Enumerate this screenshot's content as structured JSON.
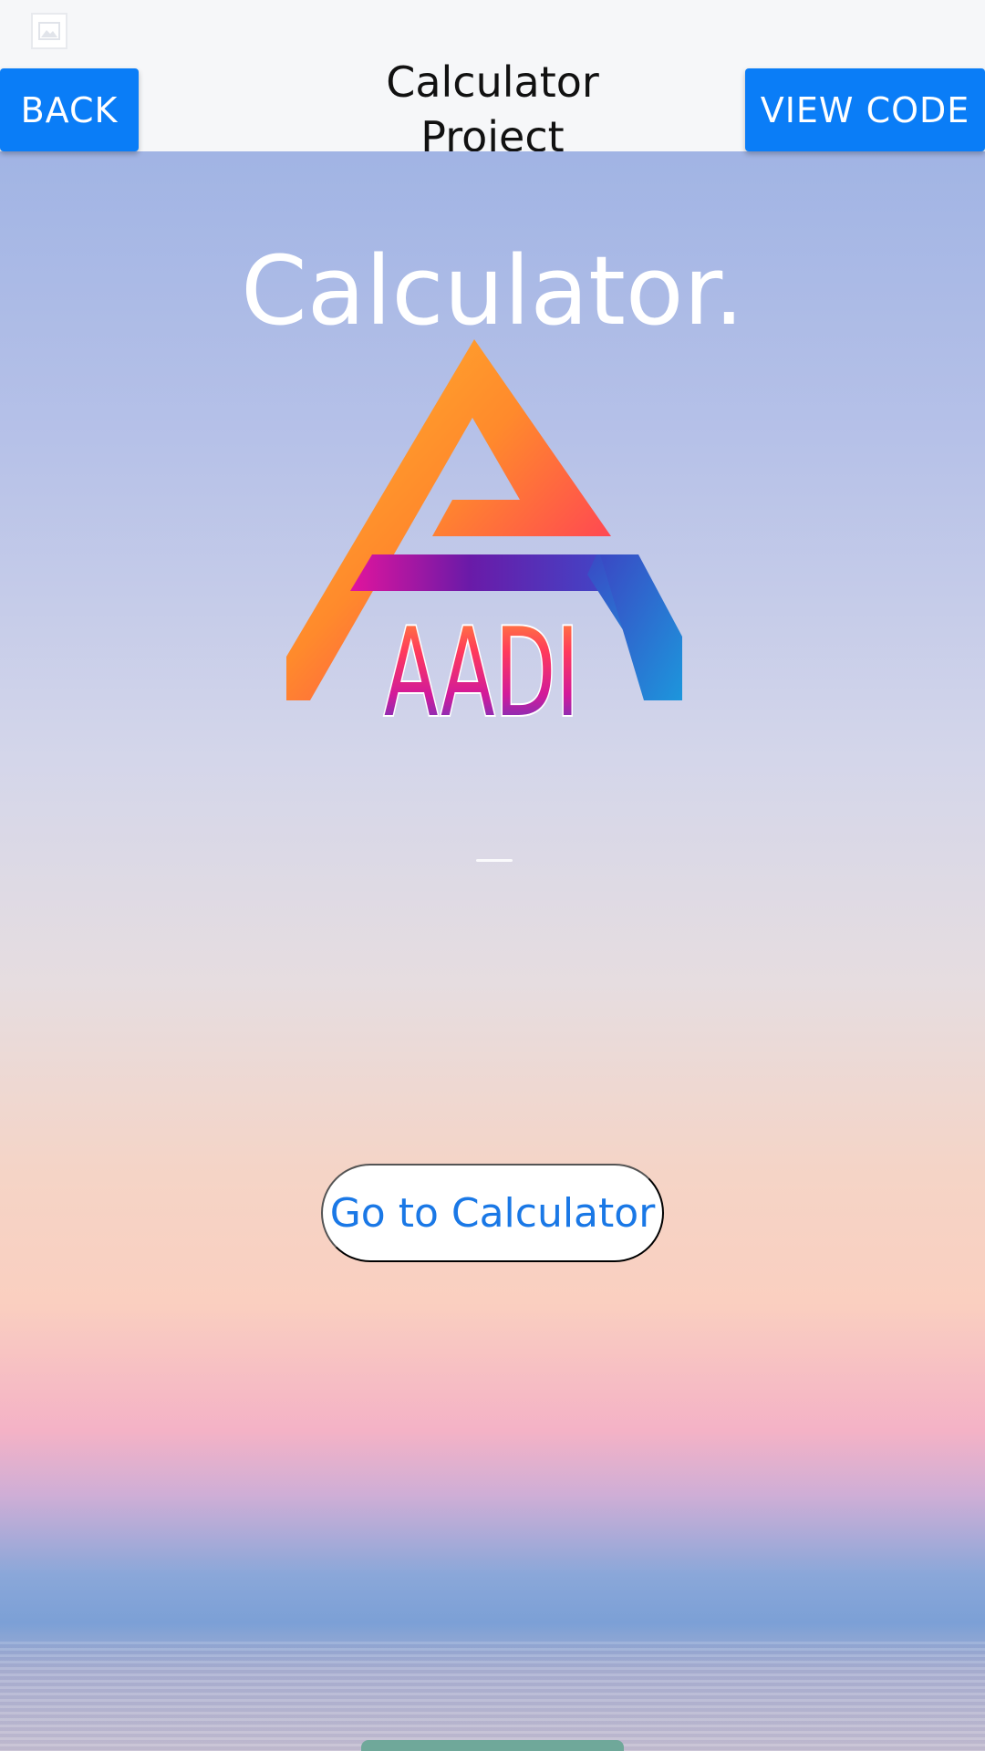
{
  "app_bar": {
    "title": "Calculator Project",
    "back_label": "BACK",
    "view_code_label": "VIEW CODE",
    "status_icon": "image-icon"
  },
  "main": {
    "heading": "Calculator.",
    "logo_text": "AADI",
    "logo_icon": "aadi-logo",
    "cta_label": "Go to Calculator"
  },
  "colors": {
    "primary_blue": "#0a7df7",
    "link_blue": "#1a78e6",
    "logo_orange": "#ffa62e",
    "logo_pink": "#ff2d7a",
    "logo_purple": "#6a1aa8",
    "logo_blue": "#1d8fdc"
  }
}
